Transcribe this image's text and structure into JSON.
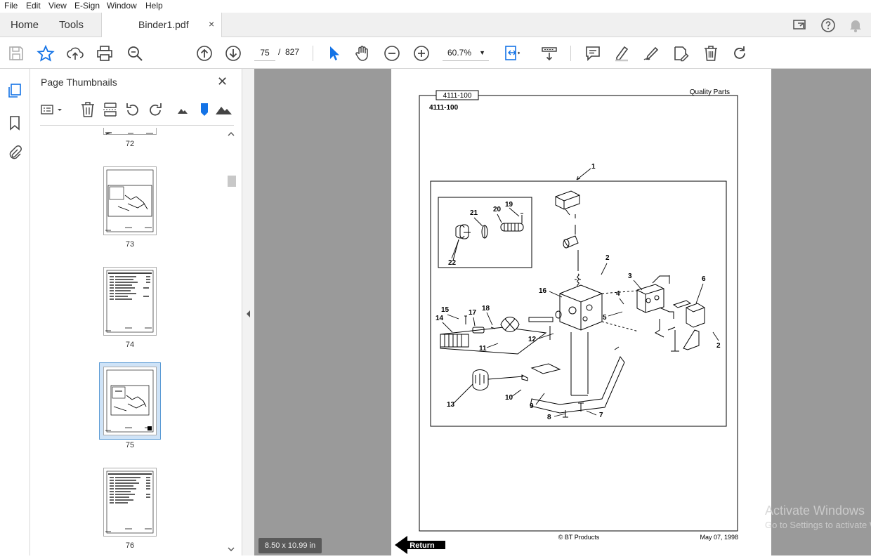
{
  "menu": [
    "File",
    "Edit",
    "View",
    "E-Sign",
    "Window",
    "Help"
  ],
  "tabs": {
    "home": "Home",
    "tools": "Tools",
    "document": "Binder1.pdf",
    "close_glyph": "×"
  },
  "toolbar": {
    "current_page": "75",
    "page_sep": "/",
    "total_pages": "827",
    "zoom": "60.7%"
  },
  "panel": {
    "title": "Page Thumbnails",
    "close_glyph": "✕",
    "thumbnails": [
      {
        "label": "72"
      },
      {
        "label": "73"
      },
      {
        "label": "74"
      },
      {
        "label": "75",
        "selected": true
      },
      {
        "label": "76"
      }
    ]
  },
  "page": {
    "tab_code": "4111-100",
    "heading_code": "4111-100",
    "brand": "Quality Parts",
    "footer_center": "© BT Products",
    "footer_date": "May 07, 1998",
    "return_label": "Return",
    "callouts": [
      "1",
      "2",
      "3",
      "4",
      "5",
      "6",
      "7",
      "8",
      "9",
      "10",
      "11",
      "12",
      "13",
      "14",
      "15",
      "16",
      "17",
      "18",
      "19",
      "20",
      "21",
      "22",
      "2"
    ]
  },
  "status": {
    "page_size": "8.50 x 10.99 in"
  },
  "watermark": {
    "line1": "Activate Windows",
    "line2": "Go to Settings to activate Windows."
  },
  "colors": {
    "accent": "#1473e6",
    "viewer_bg": "#9a9a9a",
    "selected_thumb": "#cfe3f7"
  }
}
